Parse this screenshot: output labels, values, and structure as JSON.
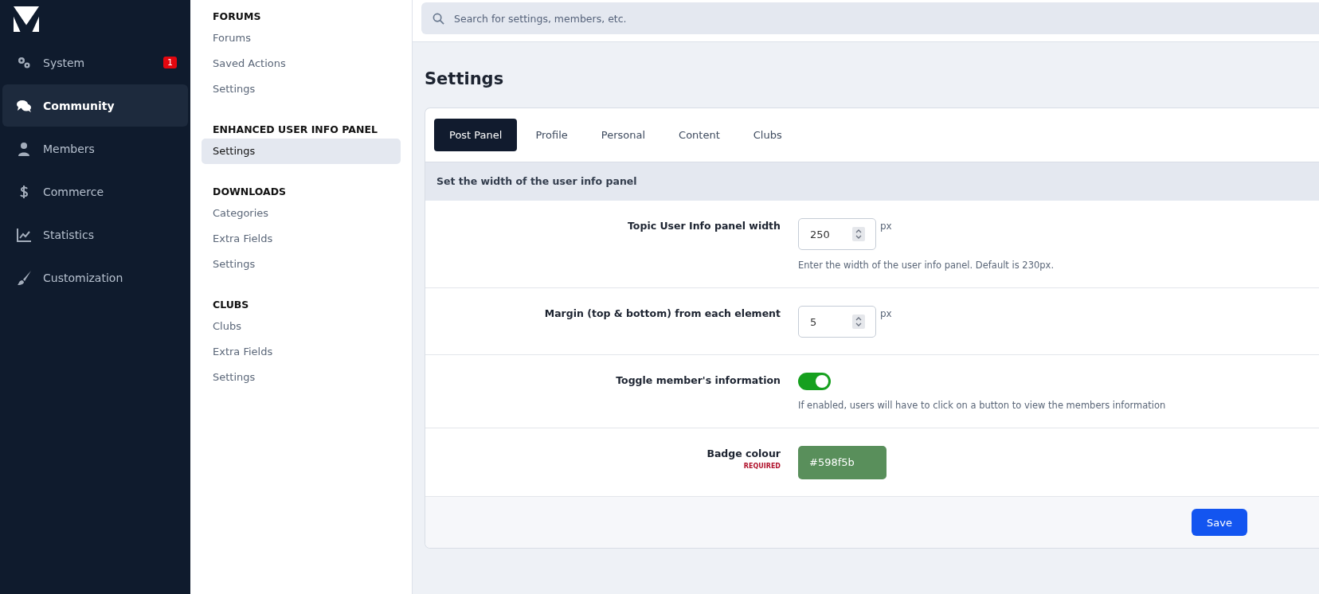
{
  "sidebar": {
    "items": [
      {
        "label": "System",
        "badge": "1",
        "selected": false
      },
      {
        "label": "Community",
        "selected": true
      },
      {
        "label": "Members",
        "selected": false
      },
      {
        "label": "Commerce",
        "selected": false
      },
      {
        "label": "Statistics",
        "selected": false
      },
      {
        "label": "Customization",
        "selected": false
      }
    ]
  },
  "submenu": {
    "sections": [
      {
        "title": "FORUMS",
        "items": [
          {
            "label": "Forums",
            "selected": false
          },
          {
            "label": "Saved Actions",
            "selected": false
          },
          {
            "label": "Settings",
            "selected": false
          }
        ]
      },
      {
        "title": "ENHANCED USER INFO PANEL",
        "items": [
          {
            "label": "Settings",
            "selected": true
          }
        ]
      },
      {
        "title": "DOWNLOADS",
        "items": [
          {
            "label": "Categories",
            "selected": false
          },
          {
            "label": "Extra Fields",
            "selected": false
          },
          {
            "label": "Settings",
            "selected": false
          }
        ]
      },
      {
        "title": "CLUBS",
        "items": [
          {
            "label": "Clubs",
            "selected": false
          },
          {
            "label": "Extra Fields",
            "selected": false
          },
          {
            "label": "Settings",
            "selected": false
          }
        ]
      }
    ]
  },
  "search": {
    "placeholder": "Search for settings, members, etc."
  },
  "page_title": "Settings",
  "tabs": [
    {
      "label": "Post Panel",
      "selected": true
    },
    {
      "label": "Profile",
      "selected": false
    },
    {
      "label": "Personal",
      "selected": false
    },
    {
      "label": "Content",
      "selected": false
    },
    {
      "label": "Clubs",
      "selected": false
    }
  ],
  "section_header": "Set the width of the user info panel",
  "settings": [
    {
      "kind": "number",
      "label": "Topic User Info panel width",
      "value": "250",
      "unit": "px",
      "description": "Enter the width of the user info panel. Default is 230px."
    },
    {
      "kind": "number",
      "label": "Margin (top & bottom) from each element",
      "value": "5",
      "unit": "px"
    },
    {
      "kind": "toggle",
      "label": "Toggle member's information",
      "on": true,
      "description": "If enabled, users will have to click on a button to view the members information"
    },
    {
      "kind": "color",
      "label": "Badge colour",
      "required": "REQUIRED",
      "value": "#598f5b",
      "color": "#598f5b"
    }
  ],
  "save_button": "Save"
}
